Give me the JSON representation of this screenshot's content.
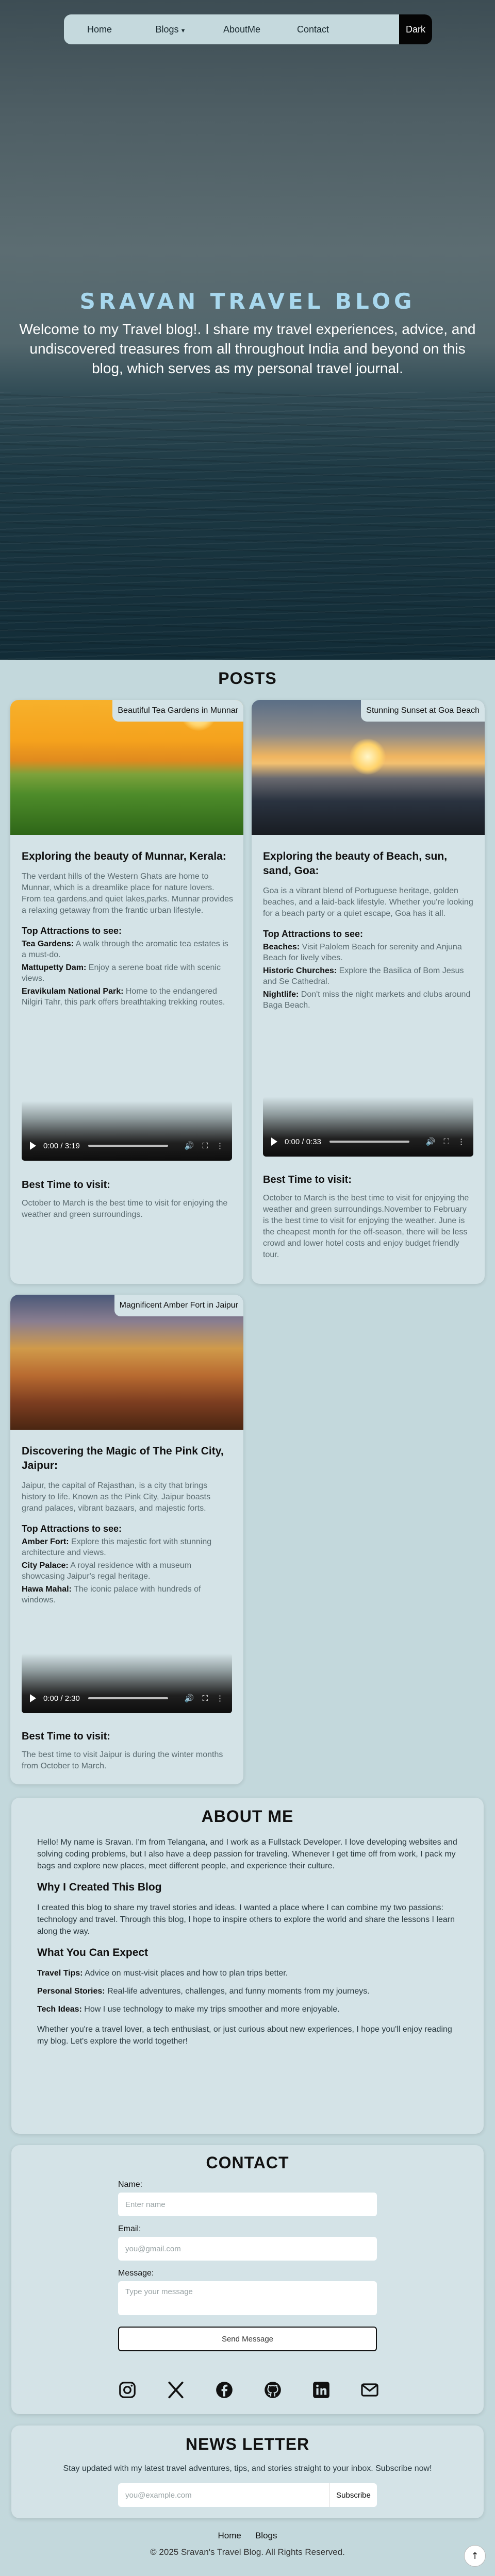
{
  "nav": {
    "items": [
      "Home",
      "Blogs",
      "AboutMe",
      "Contact"
    ],
    "dark_label": "Dark"
  },
  "hero": {
    "title": "SRAVAN TRAVEL BLOG",
    "text": "Welcome to my Travel blog!. I share my travel experiences, advice, and undiscovered treasures from all throughout India and beyond on this blog, which serves as my personal travel journal."
  },
  "posts": {
    "title": "POSTS",
    "cards": [
      {
        "caption": "Beautiful Tea Gardens in Munnar",
        "title": "Exploring the beauty of Munnar, Kerala:",
        "desc": "The verdant hills of the Western Ghats are home to Munnar, which is a dreamlike place for nature lovers. From tea gardens,and quiet lakes,parks. Munnar provides a relaxing getaway from the frantic urban lifestyle.",
        "attr_title": "Top Attractions to see:",
        "attractions": [
          {
            "name": "Tea Gardens:",
            "text": "A walk through the aromatic tea estates is a must-do."
          },
          {
            "name": "Mattupetty Dam:",
            "text": "Enjoy a serene boat ride with scenic views."
          },
          {
            "name": "Eravikulam National Park:",
            "text": "Home to the endangered Nilgiri Tahr, this park offers breathtaking trekking routes."
          }
        ],
        "video_time": "0:00 / 3:19",
        "best_title": "Best Time to visit:",
        "best_text": "October to March is the best time to visit for enjoying the weather and green surroundings."
      },
      {
        "caption": "Stunning Sunset at Goa Beach",
        "title": "Exploring the beauty of Beach, sun, sand, Goa:",
        "desc": "Goa is a vibrant blend of Portuguese heritage, golden beaches, and a laid-back lifestyle. Whether you're looking for a beach party or a quiet escape, Goa has it all.",
        "attr_title": "Top Attractions to see:",
        "attractions": [
          {
            "name": "Beaches:",
            "text": "Visit Palolem Beach for serenity and Anjuna Beach for lively vibes."
          },
          {
            "name": "Historic Churches:",
            "text": "Explore the Basilica of Bom Jesus and Se Cathedral."
          },
          {
            "name": "Nightlife:",
            "text": "Don't miss the night markets and clubs around Baga Beach."
          }
        ],
        "video_time": "0:00 / 0:33",
        "best_title": "Best Time to visit:",
        "best_text": "October to March is the best time to visit for enjoying the weather and green surroundings.November to February is the best time to visit for enjoying the weather. June is the cheapest month for the off-season, there will be less crowd and lower hotel costs and enjoy budget friendly tour."
      },
      {
        "caption": "Magnificent Amber Fort in Jaipur",
        "title": "Discovering the Magic of The Pink City, Jaipur:",
        "desc": "Jaipur, the capital of Rajasthan, is a city that brings history to life. Known as the Pink City, Jaipur boasts grand palaces, vibrant bazaars, and majestic forts.",
        "attr_title": "Top Attractions to see:",
        "attractions": [
          {
            "name": "Amber Fort:",
            "text": "Explore this majestic fort with stunning architecture and views."
          },
          {
            "name": "City Palace:",
            "text": "A royal residence with a museum showcasing Jaipur's regal heritage."
          },
          {
            "name": "Hawa Mahal:",
            "text": "The iconic palace with hundreds of windows."
          }
        ],
        "video_time": "0:00 / 2:30",
        "best_title": "Best Time to visit:",
        "best_text": "The best time to visit Jaipur is during the winter months from October to March."
      }
    ]
  },
  "about": {
    "title": "ABOUT ME",
    "intro": "Hello! My name is Sravan. I'm from Telangana, and I work as a Fullstack Developer. I love developing websites and solving coding problems, but I also have a deep passion for traveling. Whenever I get time off from work, I pack my bags and explore new places, meet different people, and experience their culture.",
    "why_title": "Why I Created This Blog",
    "why_text": "I created this blog to share my travel stories and ideas. I wanted a place where I can combine my two passions: technology and travel. Through this blog, I hope to inspire others to explore the world and share the lessons I learn along the way.",
    "expect_title": "What You Can Expect",
    "expect_items": [
      {
        "name": "Travel Tips:",
        "text": "Advice on must-visit places and how to plan trips better."
      },
      {
        "name": "Personal Stories:",
        "text": "Real-life adventures, challenges, and funny moments from my journeys."
      },
      {
        "name": "Tech Ideas:",
        "text": "How I use technology to make my trips smoother and more enjoyable."
      }
    ],
    "closing": "Whether you're a travel lover, a tech enthusiast, or just curious about new experiences, I hope you'll enjoy reading my blog. Let's explore the world together!"
  },
  "contact": {
    "title": "CONTACT",
    "name_label": "Name:",
    "name_placeholder": "Enter name",
    "email_label": "Email:",
    "email_placeholder": "you@gmail.com",
    "message_label": "Message:",
    "message_placeholder": "Type your message",
    "send_label": "Send Message",
    "social_icons": [
      "instagram-icon",
      "x-icon",
      "facebook-icon",
      "github-icon",
      "linkedin-icon",
      "mail-icon"
    ]
  },
  "newsletter": {
    "title": "NEWS LETTER",
    "text": "Stay updated with my latest travel adventures, tips, and stories straight to your inbox. Subscribe now!",
    "placeholder": "you@example.com",
    "button_label": "Subscribe"
  },
  "footer": {
    "links": [
      "Home",
      "Blogs"
    ],
    "copyright": "© 2025 Sravan's Travel Blog. All Rights Reserved."
  },
  "colors": {
    "page_bg": "#c3d8dc",
    "card_bg": "#d4e3e7",
    "hero_title": "#a8d8ee",
    "nav_bg": "#c5d9dd",
    "dark_button": "#050505"
  }
}
